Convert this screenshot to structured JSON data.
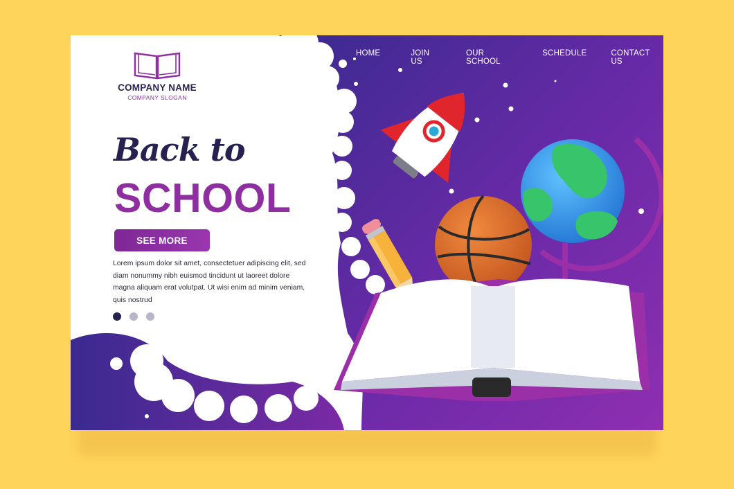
{
  "logo": {
    "icon": "open-book-icon",
    "company_name": "COMPANY NAME",
    "slogan": "COMPANY SLOGAN"
  },
  "nav": {
    "items": [
      {
        "label": "HOME"
      },
      {
        "label": "JOIN US"
      },
      {
        "label": "OUR SCHOOL"
      },
      {
        "label": "SCHEDULE"
      },
      {
        "label": "CONTACT US"
      }
    ]
  },
  "hero": {
    "title_line1": "Back to",
    "title_line2": "SCHOOL",
    "cta_label": "SEE MORE",
    "body": "Lorem ipsum dolor sit amet, consectetuer adipiscing elit, sed diam nonummy nibh euismod tincidunt ut laoreet dolore magna aliquam erat volutpat. Ut wisi enim ad minim veniam, quis nostrud"
  },
  "carousel": {
    "slide_count": 3,
    "active_index": 0
  },
  "illustration": {
    "items": [
      "rocket-icon",
      "pencil-icon",
      "basketball-icon",
      "globe-icon",
      "open-book-icon"
    ]
  },
  "colors": {
    "page_bg": "#FFD45A",
    "title_dark": "#262150",
    "accent_purple": "#8f2ea0",
    "space_purple": "#5b2aa0"
  }
}
